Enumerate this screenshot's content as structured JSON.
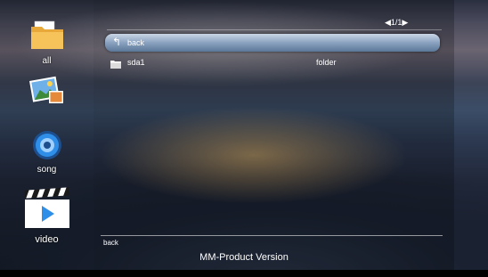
{
  "sidebar": {
    "items": [
      {
        "label": "all",
        "icon": "folder-icon"
      },
      {
        "label": "",
        "icon": "photo-icon"
      },
      {
        "label": "song",
        "icon": "music-disc-icon"
      },
      {
        "label": "video",
        "icon": "clapperboard-play-icon"
      }
    ]
  },
  "pager": {
    "text": "◀1/1▶"
  },
  "file_list": {
    "rows": [
      {
        "name": "back",
        "type": "",
        "icon": "back-arrow-icon",
        "selected": true
      },
      {
        "name": "sda1",
        "type": "folder",
        "icon": "folder-icon",
        "selected": false
      }
    ]
  },
  "footer": {
    "hint": "back",
    "version": "MM-Product Version"
  },
  "colors": {
    "selection": "#8aa2bf",
    "text": "#ffffff",
    "folder_yellow": "#f2b84a",
    "disc_blue": "#2f8fe8"
  }
}
